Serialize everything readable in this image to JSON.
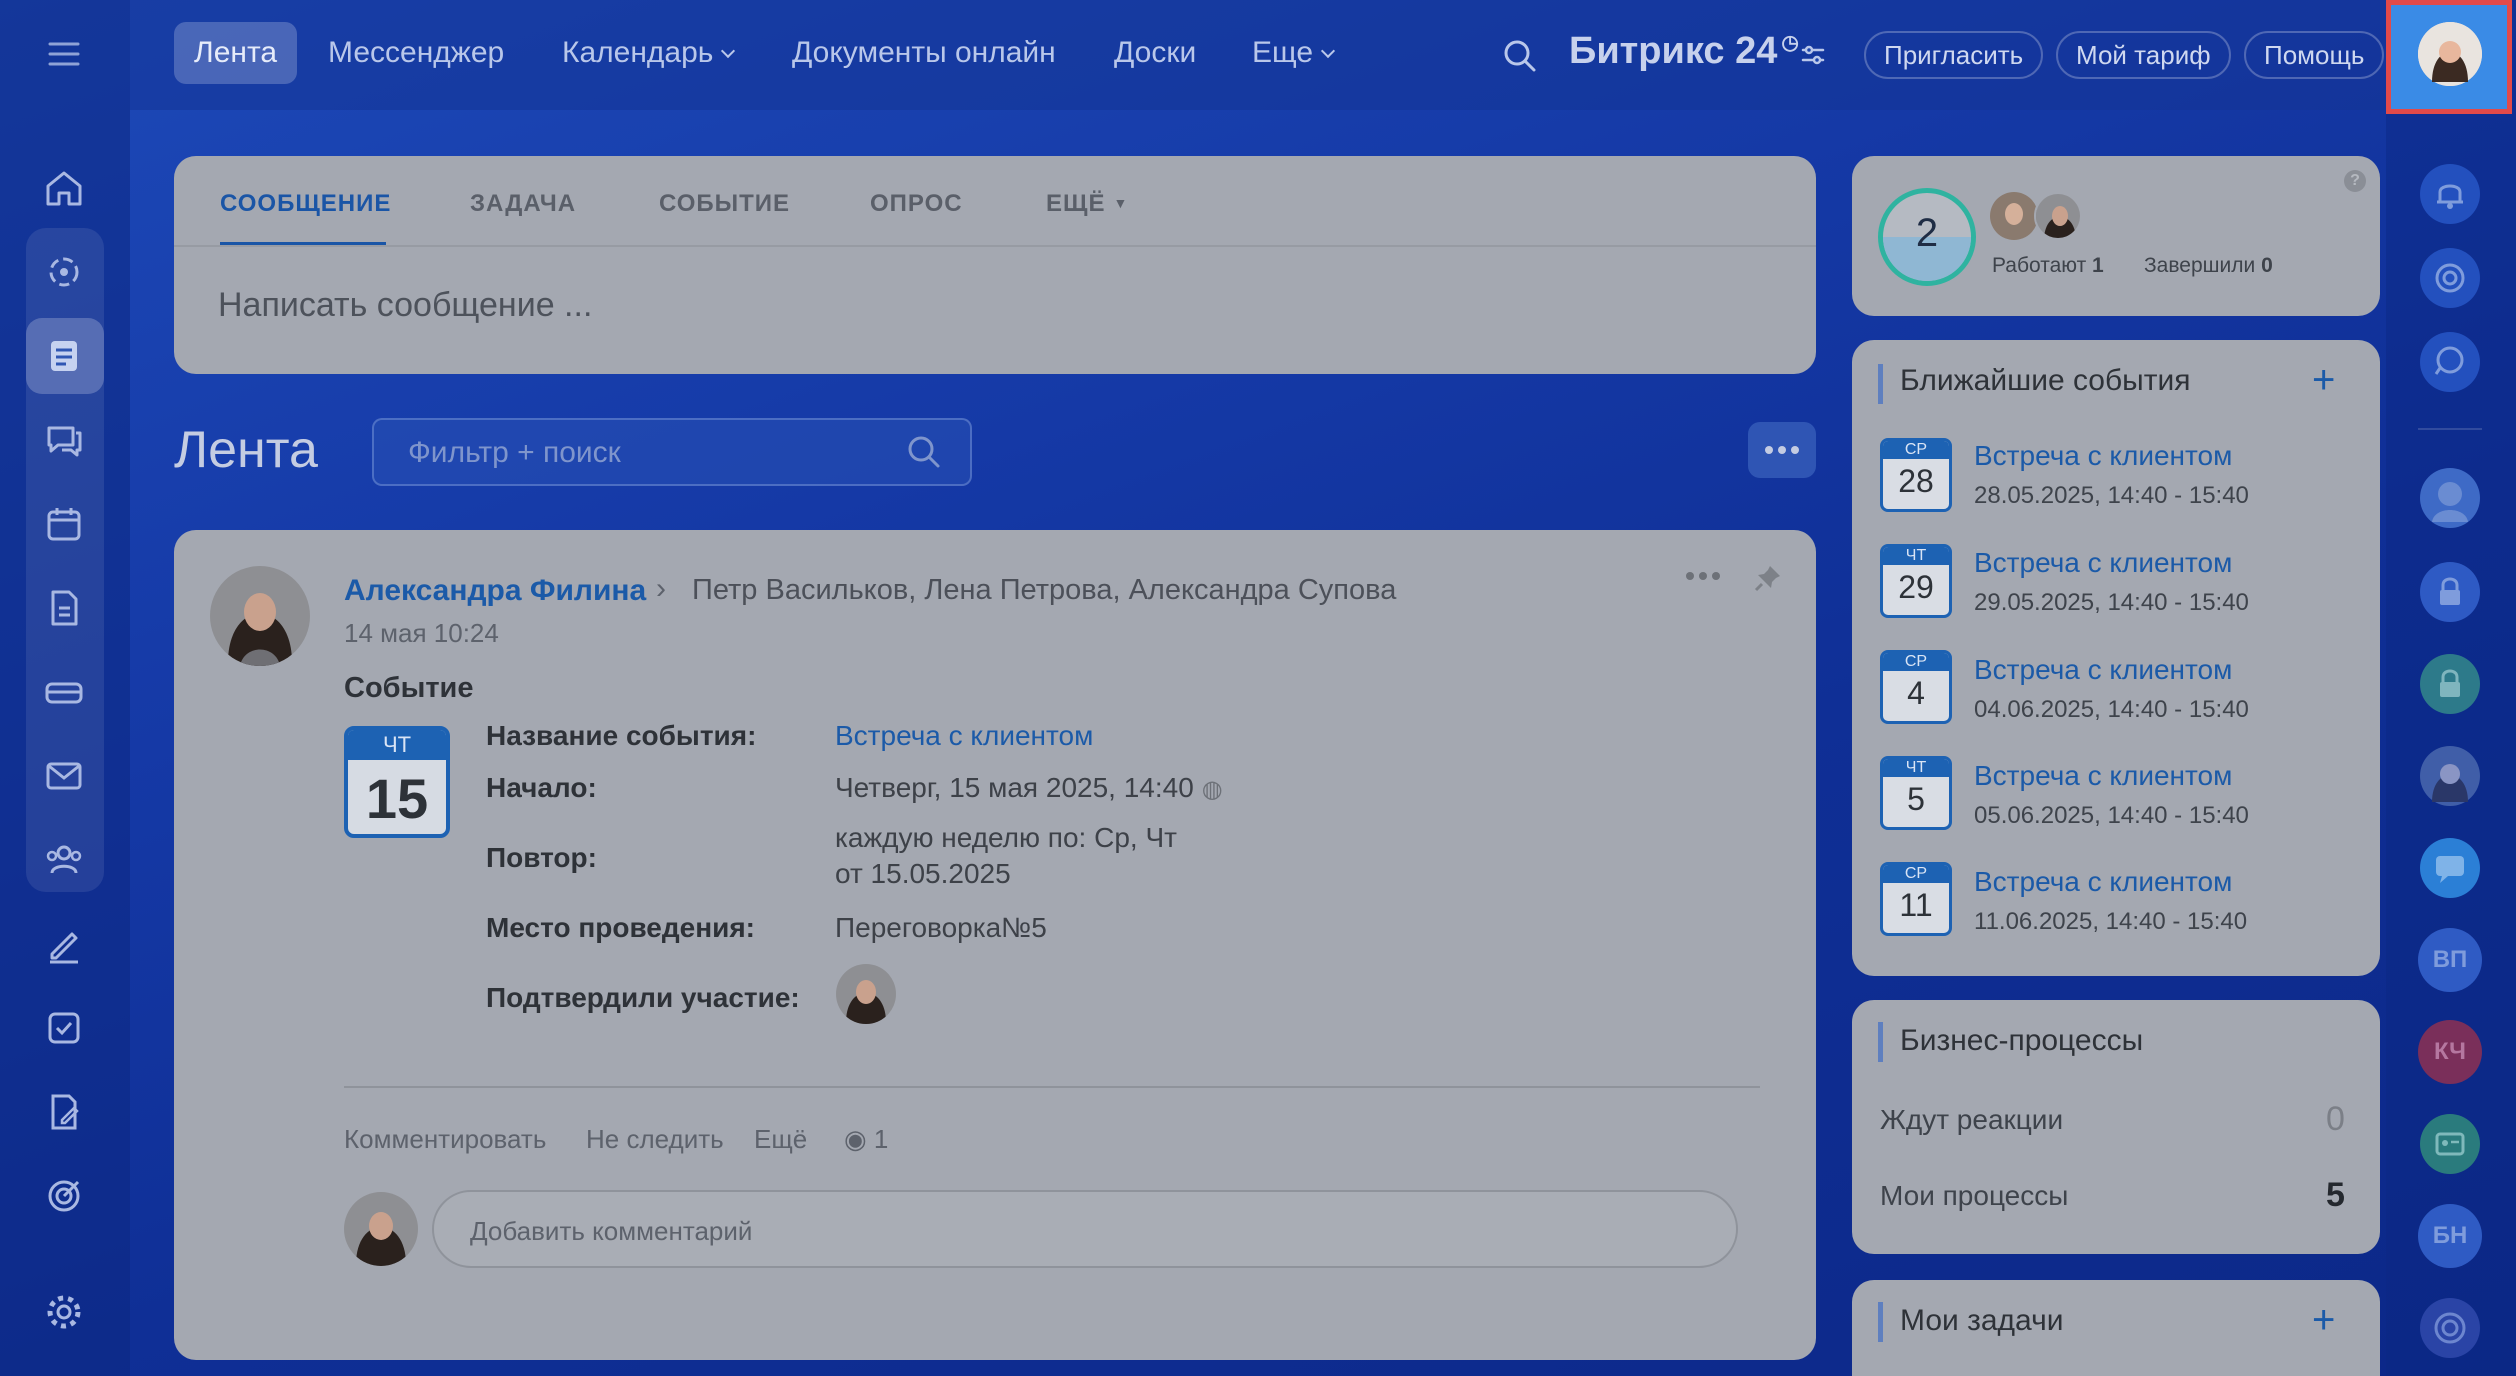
{
  "nav": {
    "items": [
      {
        "label": "Лента"
      },
      {
        "label": "Мессенджер"
      },
      {
        "label": "Календарь"
      },
      {
        "label": "Документы онлайн"
      },
      {
        "label": "Доски"
      },
      {
        "label": "Еще"
      }
    ],
    "brand_name": "Битрикс",
    "brand_num": "24",
    "invite": "Пригласить",
    "tariff": "Мой тариф",
    "help": "Помощь"
  },
  "composer": {
    "tabs": [
      "СООБЩЕНИЕ",
      "ЗАДАЧА",
      "СОБЫТИЕ",
      "ОПРОС",
      "ЕЩЁ"
    ],
    "placeholder": "Написать сообщение ..."
  },
  "feed": {
    "title": "Лента",
    "filter_placeholder": "Фильтр + поиск"
  },
  "post": {
    "author": "Александра Филина",
    "recipients": "Петр Васильков, Лена Петрова, Александра Супова",
    "time": "14 мая 10:24",
    "type": "Событие",
    "cal_day": "ЧТ",
    "cal_num": "15",
    "fields": {
      "name_label": "Название события:",
      "name_value": "Встреча с клиентом",
      "start_label": "Начало:",
      "start_value": "Четверг, 15 мая 2025, 14:40",
      "repeat_label": "Повтор:",
      "repeat_value_1": "каждую неделю по: Ср, Чт",
      "repeat_value_2": "от 15.05.2025",
      "place_label": "Место проведения:",
      "place_value": "Переговорка№5",
      "confirmed_label": "Подтвердили участие:"
    },
    "actions": {
      "comment": "Комментировать",
      "unfollow": "Не следить",
      "more": "Ещё",
      "views": "1"
    },
    "comment_placeholder": "Добавить комментарий"
  },
  "worktime": {
    "count": "2",
    "working_label": "Работают",
    "working_count": "1",
    "done_label": "Завершили",
    "done_count": "0"
  },
  "events": {
    "title": "Ближайшие события",
    "items": [
      {
        "day": "СР",
        "num": "28",
        "title": "Встреча с клиентом",
        "time": "28.05.2025, 14:40 - 15:40"
      },
      {
        "day": "ЧТ",
        "num": "29",
        "title": "Встреча с клиентом",
        "time": "29.05.2025, 14:40 - 15:40"
      },
      {
        "day": "СР",
        "num": "4",
        "title": "Встреча с клиентом",
        "time": "04.06.2025, 14:40 - 15:40"
      },
      {
        "day": "ЧТ",
        "num": "5",
        "title": "Встреча с клиентом",
        "time": "05.06.2025, 14:40 - 15:40"
      },
      {
        "day": "СР",
        "num": "11",
        "title": "Встреча с клиентом",
        "time": "11.06.2025, 14:40 - 15:40"
      }
    ]
  },
  "bp": {
    "title": "Бизнес-процессы",
    "waiting_label": "Ждут реакции",
    "waiting_count": "0",
    "mine_label": "Мои процессы",
    "mine_count": "5"
  },
  "tasks": {
    "title": "Мои задачи"
  },
  "right_rail": {
    "initials": [
      "ВП",
      "КЧ",
      "БН"
    ]
  },
  "colors": {
    "accent": "#1b5aa8",
    "background": "#1539a6",
    "highlight": "#e24a4a"
  }
}
